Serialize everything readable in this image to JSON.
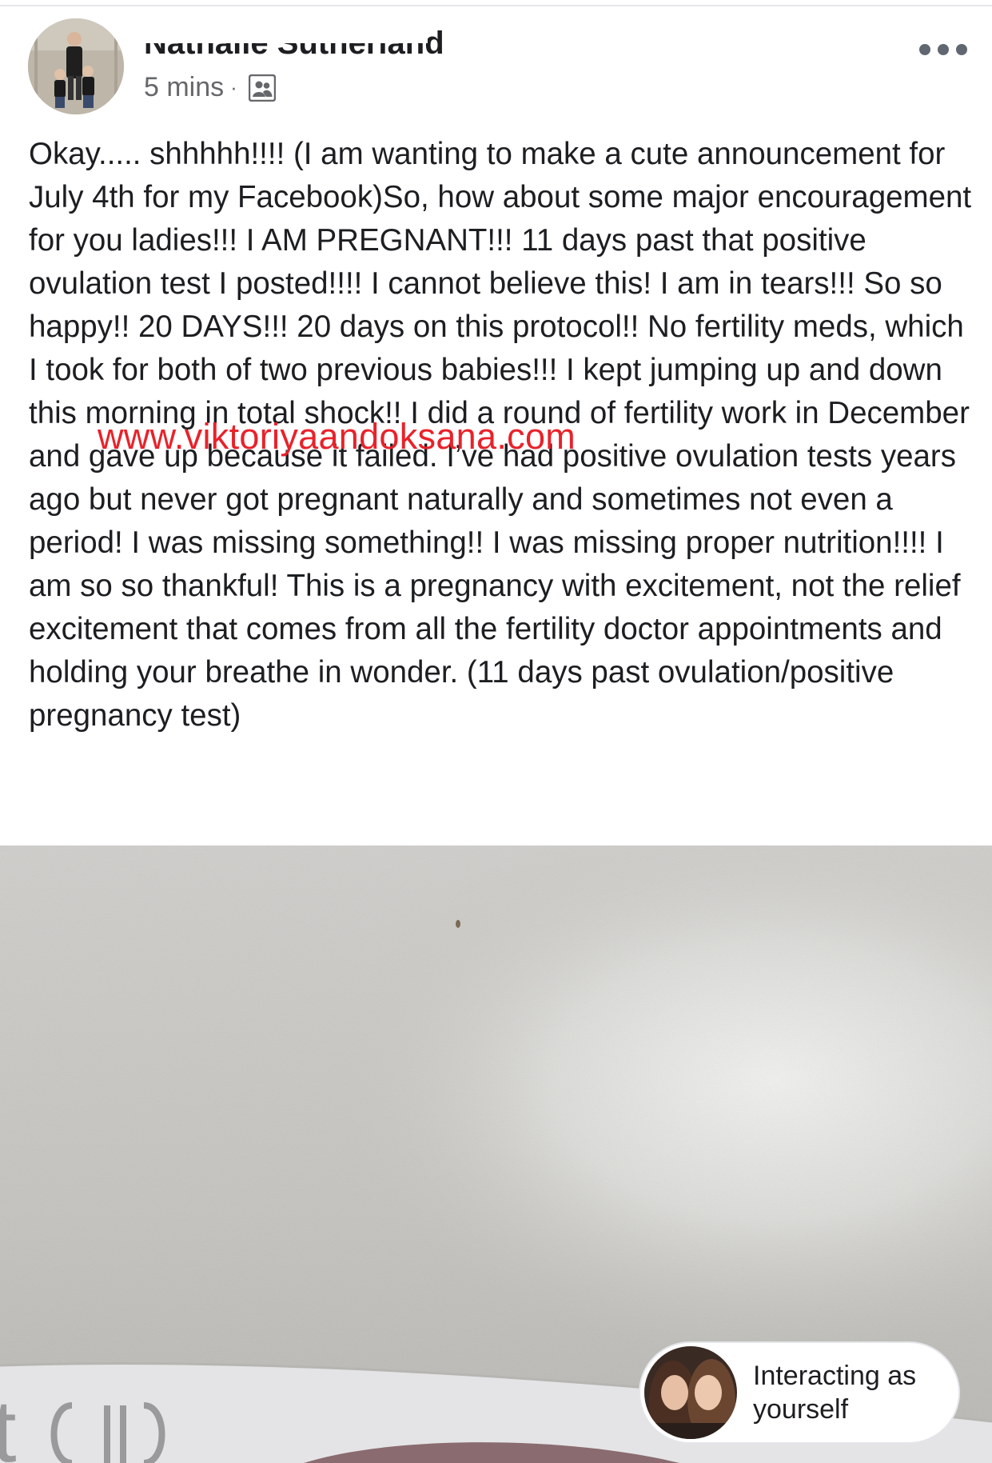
{
  "post": {
    "author_first": "Nathalie",
    "author_last": "Sutherland",
    "timestamp": "5 mins",
    "separator": "·",
    "audience_icon": "friends-audience-icon",
    "text": "Okay..... shhhhh!!!! (I am wanting to make a cute announcement for July 4th for my Facebook)So, how about some major encouragement for you ladies!!! I AM PREGNANT!!! 11 days past that positive ovulation test I posted!!!! I cannot believe this! I am in tears!!! So so happy!! 20 DAYS!!! 20 days on this protocol!! No fertility meds, which I took for both of two previous babies!!! I kept jumping up and down this morning in total shock!! I did a round of fertility work in December and gave up because it failed. I’ve had positive ovulation tests years ago but never got pregnant naturally and sometimes not even a period! I was missing something!! I was missing proper nutrition!!!! I am so so thankful! This is a pregnancy with excitement, not the relief excitement that comes from all the fertility doctor appointments and holding your breathe in wonder. (11 days past ovulation/positive pregnancy test)",
    "watermark": "www.viktoriyaandoksana.com"
  },
  "photo": {
    "test_text": "t"
  },
  "interacting_chip": {
    "label": "Interacting as yourself"
  },
  "colors": {
    "text": "#1c1e21",
    "meta": "#65676b",
    "watermark": "#e8222a",
    "photo_bg": "#c9c8c4"
  }
}
